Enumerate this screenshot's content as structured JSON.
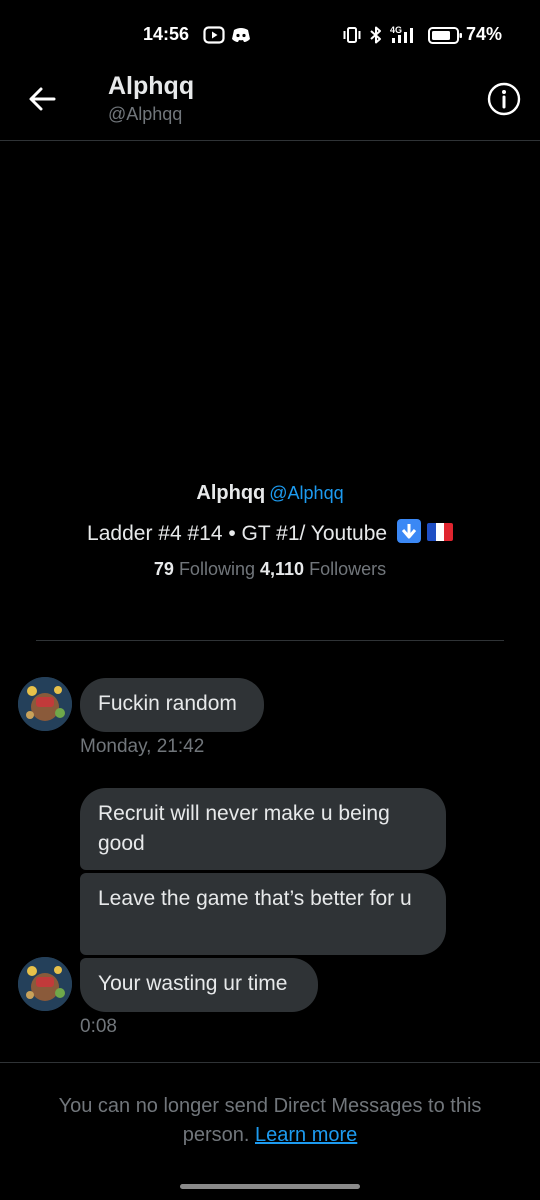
{
  "status_bar": {
    "time": "14:56",
    "battery_percent": "74%",
    "network_label": "4G",
    "icons": [
      "youtube-icon",
      "discord-icon",
      "vibrate-icon",
      "bluetooth-icon",
      "signal-icon",
      "battery-icon"
    ]
  },
  "header": {
    "name": "Alphqq",
    "handle": "@Alphqq",
    "back_icon": "back-arrow-icon",
    "info_icon": "info-icon"
  },
  "profile": {
    "name": "Alphqq",
    "handle": "@Alphqq",
    "bio_text": "Ladder #4 #14 • GT #1/ Youtube",
    "bio_emojis": [
      "down-arrow-emoji",
      "france-flag-emoji"
    ],
    "following_count": "79",
    "following_label": "Following",
    "followers_count": "4,110",
    "followers_label": "Followers"
  },
  "messages": [
    {
      "text": "Fuckin random"
    },
    {
      "text": "Recruit will never make u being good"
    },
    {
      "text": "Leave the game that’s better for u"
    },
    {
      "text": "Your wasting ur time"
    }
  ],
  "timestamps": {
    "first": "Monday, 21:42",
    "second": "0:08"
  },
  "footer": {
    "text": "You can no longer send Direct Messages to this person.",
    "link_label": "Learn more"
  },
  "colors": {
    "background": "#000000",
    "bubble": "#2f3336",
    "accent": "#1d9bf0",
    "muted": "#71767b"
  }
}
